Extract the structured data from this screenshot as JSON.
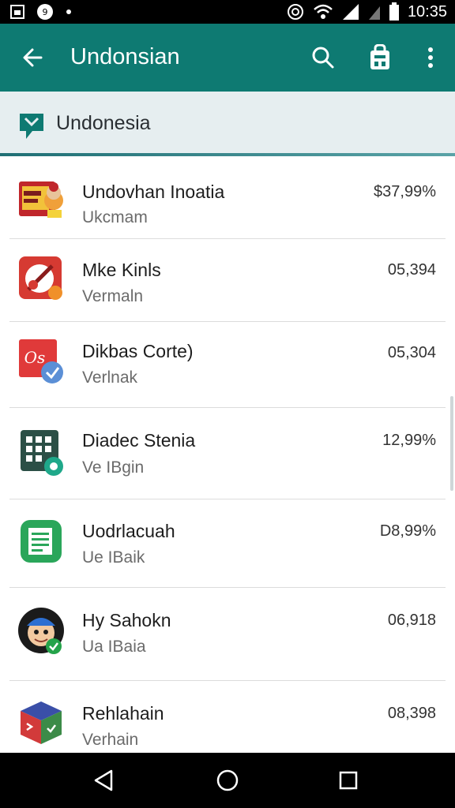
{
  "status_bar": {
    "time": "10:35"
  },
  "app_bar": {
    "title": "Undonsian",
    "icons": [
      "back-arrow-icon",
      "search-icon",
      "store-bag-icon",
      "more-vert-icon"
    ]
  },
  "sub_header": {
    "label": "Undonesia",
    "icon": "chat-bubble-icon"
  },
  "items": [
    {
      "name": "Undovhan Inoatia",
      "sub": "Ukcmam",
      "value": "$37,99%",
      "icon": "toy-box-icon"
    },
    {
      "name": "Mke Kinls",
      "sub": "Vermaln",
      "value": "05,394",
      "icon": "music-guitar-icon"
    },
    {
      "name": "Dikbas Corte)",
      "sub": "Verlnak",
      "value": "05,304",
      "icon": "office-badge-icon"
    },
    {
      "name": "Diadec Stenia",
      "sub": "Ve IBgin",
      "value": "12,99%",
      "icon": "calculator-grid-icon"
    },
    {
      "name": "Uodrlacuah",
      "sub": "Ue IBaik",
      "value": "D8,99%",
      "icon": "document-icon"
    },
    {
      "name": "Hy Sahokn",
      "sub": "Ua IBaia",
      "value": "06,918",
      "icon": "avatar-face-icon"
    },
    {
      "name": "Rehlahain",
      "sub": "Verhain",
      "value": "08,398",
      "icon": "cube-icon"
    }
  ],
  "nav_bar": {
    "icons": [
      "nav-back-icon",
      "nav-home-icon",
      "nav-recents-icon"
    ]
  },
  "colors": {
    "accent": "#0e7a72",
    "subheader_bg": "#e6eef0",
    "status_bg": "#000000"
  }
}
